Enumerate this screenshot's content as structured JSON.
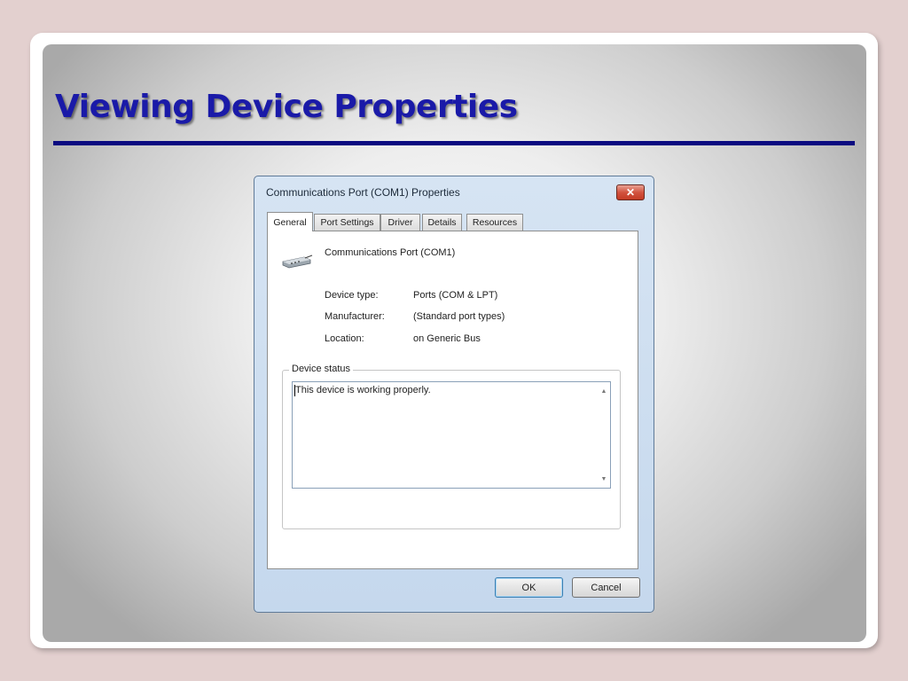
{
  "slide": {
    "title": "Viewing Device Properties"
  },
  "dialog": {
    "title": "Communications Port (COM1) Properties",
    "close_symbol": "✕",
    "tabs": [
      "General",
      "Port Settings",
      "Driver",
      "Details",
      "Resources"
    ],
    "active_tab": "General",
    "device_name": "Communications Port (COM1)",
    "device_icon": "serial-port-icon",
    "properties": [
      {
        "label": "Device type:",
        "value": "Ports (COM & LPT)"
      },
      {
        "label": "Manufacturer:",
        "value": "(Standard port types)"
      },
      {
        "label": "Location:",
        "value": "on Generic Bus"
      }
    ],
    "status_group": "Device status",
    "status_text": "This device is working properly.",
    "buttons": {
      "ok": "OK",
      "cancel": "Cancel"
    }
  },
  "colors": {
    "title_text": "#1a1aa8",
    "title_rule": "#0a0a80",
    "outer_background": "#e3d0cf",
    "close_button": "#c33a24"
  }
}
